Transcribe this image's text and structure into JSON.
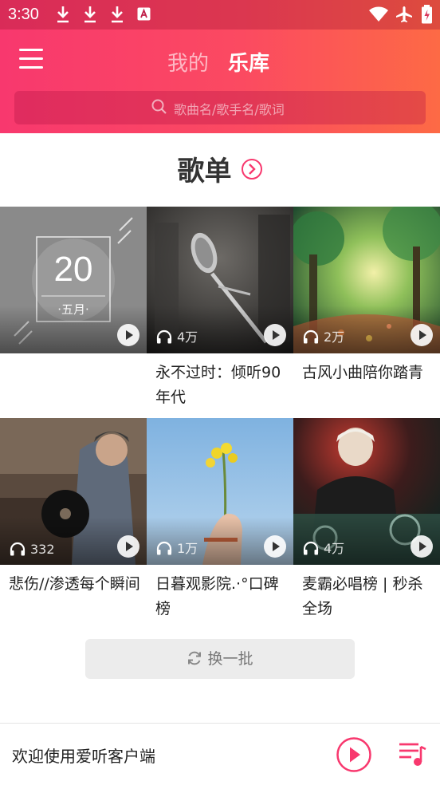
{
  "status_bar": {
    "time": "3:30",
    "icons": [
      "download-icon",
      "download-icon",
      "download-icon",
      "font-app-icon",
      "wifi-icon",
      "airplane-icon",
      "battery-charging-icon"
    ]
  },
  "header": {
    "tabs": [
      {
        "label": "我的",
        "active": false
      },
      {
        "label": "乐库",
        "active": true
      }
    ]
  },
  "search": {
    "placeholder": "歌曲名/歌手名/歌词"
  },
  "section": {
    "title": "歌单"
  },
  "playlists": [
    {
      "date_day": "20",
      "date_month": "·五月·",
      "count": "",
      "title": ""
    },
    {
      "count": "4万",
      "title": "永不过时：倾听90年代"
    },
    {
      "count": "2万",
      "title": "古风小曲陪你踏青"
    },
    {
      "count": "332",
      "title": "悲伤//渗透每个瞬间"
    },
    {
      "count": "1万",
      "title": "日暮观影院.·°口碑榜"
    },
    {
      "count": "4万",
      "title": "麦霸必唱榜 | 秒杀全场"
    }
  ],
  "refresh": {
    "label": "换一批"
  },
  "player": {
    "text": "欢迎使用爱听客户端"
  },
  "colors": {
    "accent": "#f8386e",
    "accent_end": "#fd6a45"
  }
}
